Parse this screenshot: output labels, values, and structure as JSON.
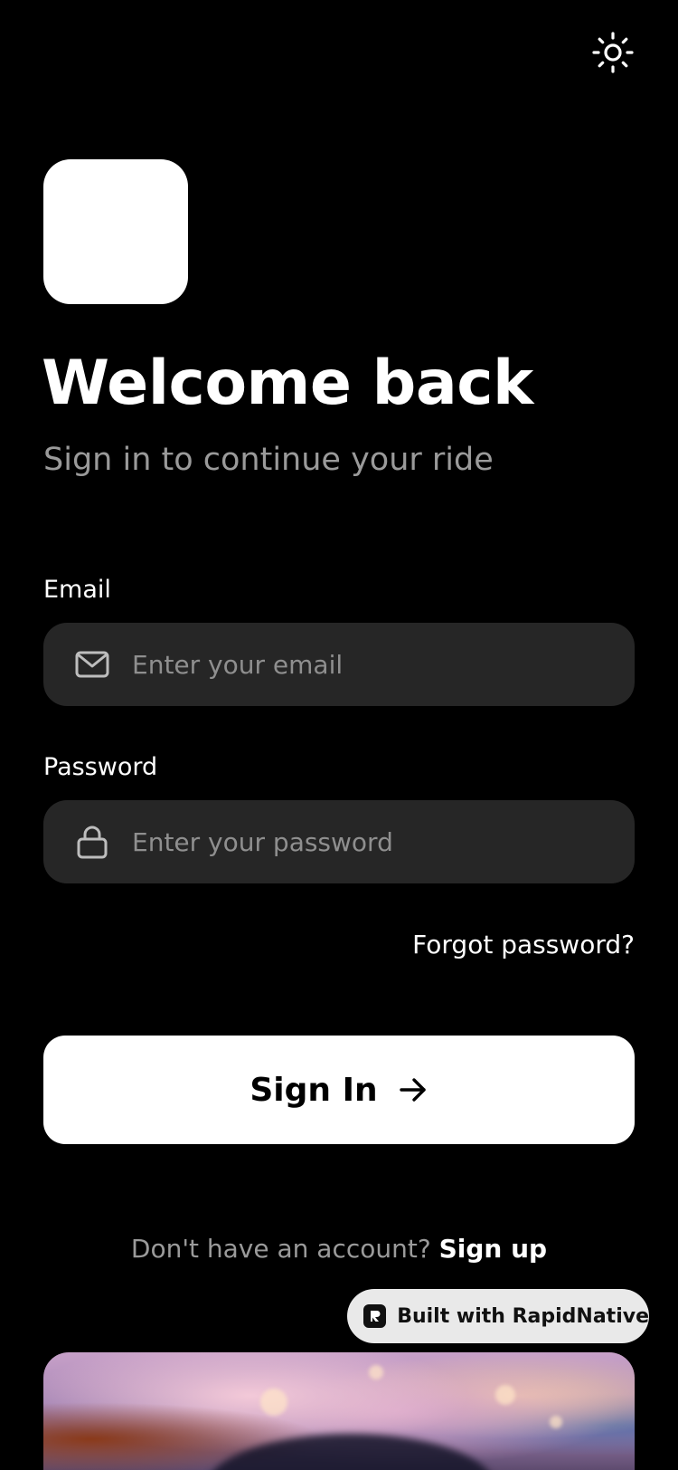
{
  "header": {
    "theme_toggle_icon": "sun-icon"
  },
  "welcome": {
    "title": "Welcome back",
    "subtitle": "Sign in to continue your ride"
  },
  "form": {
    "email": {
      "label": "Email",
      "placeholder": "Enter your email",
      "value": "",
      "icon": "mail-icon"
    },
    "password": {
      "label": "Password",
      "placeholder": "Enter your password",
      "value": "",
      "icon": "lock-icon"
    },
    "forgot_label": "Forgot password?",
    "submit_label": "Sign In",
    "submit_icon": "arrow-right-icon"
  },
  "signup": {
    "prompt": "Don't have an account? ",
    "link_label": "Sign up"
  },
  "badge": {
    "label": "Built with RapidNative"
  },
  "colors": {
    "background": "#000000",
    "input_background": "#262626",
    "primary_button": "#ffffff",
    "muted_text": "#9a9a9a"
  }
}
